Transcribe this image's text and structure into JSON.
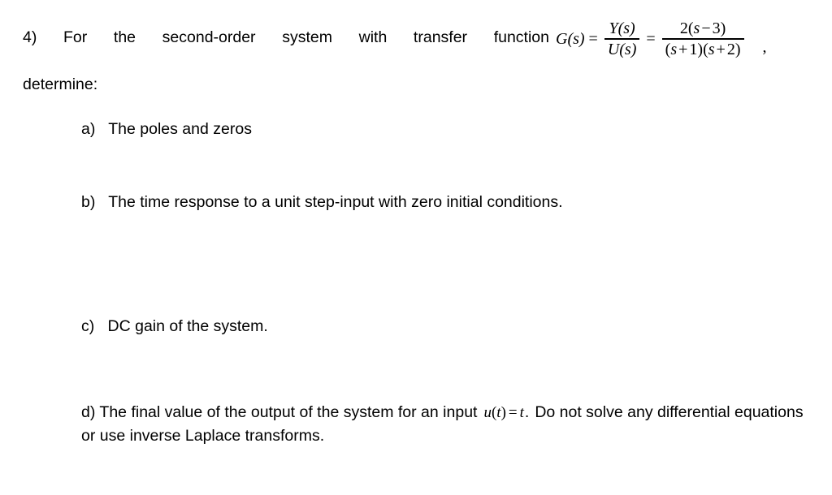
{
  "document": {
    "background_color": "#ffffff",
    "text_color": "#000000",
    "problem_number": "4)",
    "intro": {
      "text": "For the second-order system with transfer function",
      "determine_label": "determine:"
    },
    "equation": {
      "lhs": "G(s)",
      "eq1": "=",
      "fraction_1": {
        "numerator": "Y(s)",
        "denominator": "U(s)"
      },
      "eq2": "=",
      "fraction_2": {
        "numerator": "2(s − 3)",
        "numerator_parts": {
          "coefficient": "2",
          "open": "(",
          "variable": "s",
          "operator": "−",
          "constant": "3",
          "close": ")"
        },
        "denominator": "(s + 1)(s + 2)",
        "denominator_parts": {
          "factor1_open": "(",
          "factor1_variable": "s",
          "factor1_operator": "+",
          "factor1_constant": "1",
          "factor1_close": ")",
          "factor2_open": "(",
          "factor2_variable": "s",
          "factor2_operator": "+",
          "factor2_constant": "2",
          "factor2_close": ")"
        }
      },
      "trailing_punctuation": ","
    },
    "items": [
      {
        "marker": "a)",
        "text": "The poles and zeros"
      },
      {
        "marker": "b)",
        "text": "The time response to a unit step-input with zero initial conditions."
      },
      {
        "marker": "c)",
        "text": "DC gain of the system."
      },
      {
        "marker": "d)",
        "text_before_math": "The final value of the output of the system for an input",
        "inline_math": {
          "variable": "u",
          "open": "(",
          "argument": "t",
          "close": ")",
          "operator": "=",
          "value": "t"
        },
        "text_after_math": ".",
        "text_continued": "Do not solve any differential equations or use inverse Laplace transforms."
      }
    ]
  }
}
